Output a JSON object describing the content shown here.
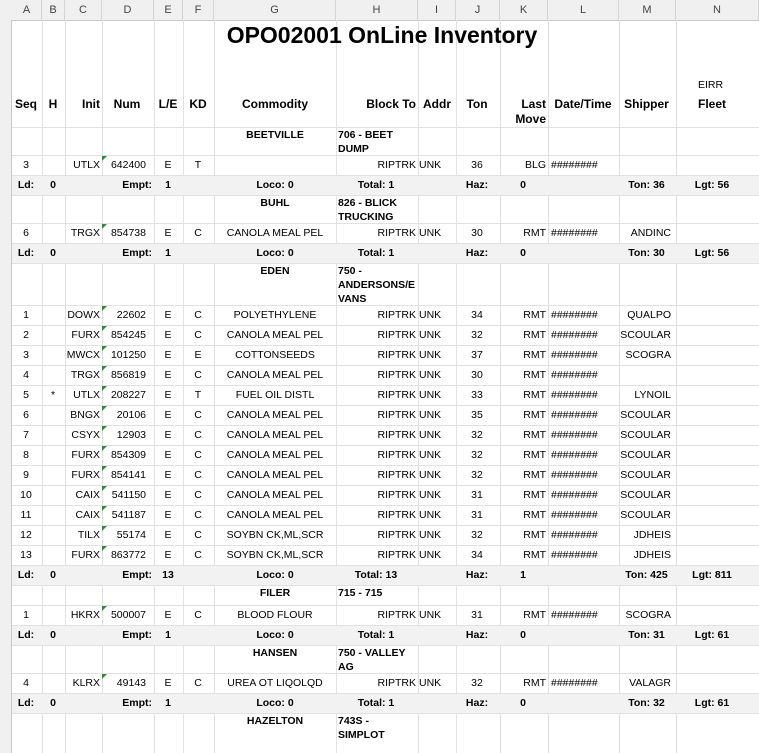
{
  "col_letters": [
    "A",
    "B",
    "C",
    "D",
    "E",
    "F",
    "G",
    "H",
    "I",
    "J",
    "K",
    "L",
    "M",
    "N"
  ],
  "title": "OPO02001 OnLine Inventory",
  "eirr": "EIRR",
  "headers": {
    "seq": "Seq",
    "h": "H",
    "init": "Init",
    "num": "Num",
    "le": "L/E",
    "kd": "KD",
    "commodity": "Commodity",
    "block": "Block To",
    "addr": "Addr",
    "ton": "Ton",
    "last1": "Last",
    "last2": "Move",
    "dt": "Date/Time",
    "shipper": "Shipper",
    "fleet": "Fleet"
  },
  "row_numbers": [
    "",
    "",
    "",
    "",
    "",
    "",
    "",
    "",
    "",
    "",
    "",
    "",
    "",
    "",
    "",
    "",
    "",
    "",
    "",
    "",
    "",
    "",
    "",
    "",
    "",
    "",
    "",
    "",
    "",
    "",
    "",
    "",
    "",
    ""
  ],
  "groups": [
    {
      "name": "BEETVILLE",
      "block": [
        "706 - BEET",
        "DUMP"
      ],
      "rows": [
        {
          "seq": "3",
          "h": "",
          "init": "UTLX",
          "num": "642400",
          "le": "E",
          "kd": "T",
          "commodity": "",
          "block": "RIPTRK",
          "addr": "UNK",
          "ton": "36",
          "last": "BLG",
          "dt": "########",
          "shipper": ""
        }
      ],
      "sum": {
        "ld": "Ld:",
        "ld_v": "0",
        "empt": "Empt:",
        "empt_v": "1",
        "loco": "Loco:  0",
        "total": "Total:  1",
        "haz": "Haz:",
        "haz_v": "0",
        "ton": "Ton: 36",
        "lgt": "Lgt: 56"
      }
    },
    {
      "name": "BUHL",
      "block": [
        "826 - BLICK",
        "TRUCKING"
      ],
      "rows": [
        {
          "seq": "6",
          "h": "",
          "init": "TRGX",
          "num": "854738",
          "le": "E",
          "kd": "C",
          "commodity": "CANOLA MEAL PEL",
          "block": "RIPTRK",
          "addr": "UNK",
          "ton": "30",
          "last": "RMT",
          "dt": "########",
          "shipper": "ANDINC"
        }
      ],
      "sum": {
        "ld": "Ld:",
        "ld_v": "0",
        "empt": "Empt:",
        "empt_v": "1",
        "loco": "Loco:  0",
        "total": "Total:  1",
        "haz": "Haz:",
        "haz_v": "0",
        "ton": "Ton: 30",
        "lgt": "Lgt: 56"
      }
    },
    {
      "name": "EDEN",
      "block": [
        "750 -",
        "ANDERSONS/E",
        "VANS"
      ],
      "rows": [
        {
          "seq": "1",
          "h": "",
          "init": "DOWX",
          "num": "22602",
          "le": "E",
          "kd": "C",
          "commodity": "POLYETHYLENE",
          "block": "RIPTRK",
          "addr": "UNK",
          "ton": "34",
          "last": "RMT",
          "dt": "########",
          "shipper": "QUALPO"
        },
        {
          "seq": "2",
          "h": "",
          "init": "FURX",
          "num": "854245",
          "le": "E",
          "kd": "C",
          "commodity": "CANOLA MEAL PEL",
          "block": "RIPTRK",
          "addr": "UNK",
          "ton": "32",
          "last": "RMT",
          "dt": "########",
          "shipper": "SCOULAR"
        },
        {
          "seq": "3",
          "h": "",
          "init": "MWCX",
          "num": "101250",
          "le": "E",
          "kd": "E",
          "commodity": "COTTONSEEDS",
          "block": "RIPTRK",
          "addr": "UNK",
          "ton": "37",
          "last": "RMT",
          "dt": "########",
          "shipper": "SCOGRA"
        },
        {
          "seq": "4",
          "h": "",
          "init": "TRGX",
          "num": "856819",
          "le": "E",
          "kd": "C",
          "commodity": "CANOLA MEAL PEL",
          "block": "RIPTRK",
          "addr": "UNK",
          "ton": "30",
          "last": "RMT",
          "dt": "########",
          "shipper": ""
        },
        {
          "seq": "5",
          "h": "*",
          "init": "UTLX",
          "num": "208227",
          "le": "E",
          "kd": "T",
          "commodity": "FUEL OIL DISTL",
          "block": "RIPTRK",
          "addr": "UNK",
          "ton": "33",
          "last": "RMT",
          "dt": "########",
          "shipper": "LYNOIL"
        },
        {
          "seq": "6",
          "h": "",
          "init": "BNGX",
          "num": "20106",
          "le": "E",
          "kd": "C",
          "commodity": "CANOLA MEAL PEL",
          "block": "RIPTRK",
          "addr": "UNK",
          "ton": "35",
          "last": "RMT",
          "dt": "########",
          "shipper": "SCOULAR"
        },
        {
          "seq": "7",
          "h": "",
          "init": "CSYX",
          "num": "12903",
          "le": "E",
          "kd": "C",
          "commodity": "CANOLA MEAL PEL",
          "block": "RIPTRK",
          "addr": "UNK",
          "ton": "32",
          "last": "RMT",
          "dt": "########",
          "shipper": "SCOULAR"
        },
        {
          "seq": "8",
          "h": "",
          "init": "FURX",
          "num": "854309",
          "le": "E",
          "kd": "C",
          "commodity": "CANOLA MEAL PEL",
          "block": "RIPTRK",
          "addr": "UNK",
          "ton": "32",
          "last": "RMT",
          "dt": "########",
          "shipper": "SCOULAR"
        },
        {
          "seq": "9",
          "h": "",
          "init": "FURX",
          "num": "854141",
          "le": "E",
          "kd": "C",
          "commodity": "CANOLA MEAL PEL",
          "block": "RIPTRK",
          "addr": "UNK",
          "ton": "32",
          "last": "RMT",
          "dt": "########",
          "shipper": "SCOULAR"
        },
        {
          "seq": "10",
          "h": "",
          "init": "CAIX",
          "num": "541150",
          "le": "E",
          "kd": "C",
          "commodity": "CANOLA MEAL PEL",
          "block": "RIPTRK",
          "addr": "UNK",
          "ton": "31",
          "last": "RMT",
          "dt": "########",
          "shipper": "SCOULAR"
        },
        {
          "seq": "11",
          "h": "",
          "init": "CAIX",
          "num": "541187",
          "le": "E",
          "kd": "C",
          "commodity": "CANOLA MEAL PEL",
          "block": "RIPTRK",
          "addr": "UNK",
          "ton": "31",
          "last": "RMT",
          "dt": "########",
          "shipper": "SCOULAR"
        },
        {
          "seq": "12",
          "h": "",
          "init": "TILX",
          "num": "55174",
          "le": "E",
          "kd": "C",
          "commodity": "SOYBN CK,ML,SCR",
          "block": "RIPTRK",
          "addr": "UNK",
          "ton": "32",
          "last": "RMT",
          "dt": "########",
          "shipper": "JDHEIS"
        },
        {
          "seq": "13",
          "h": "",
          "init": "FURX",
          "num": "863772",
          "le": "E",
          "kd": "C",
          "commodity": "SOYBN CK,ML,SCR",
          "block": "RIPTRK",
          "addr": "UNK",
          "ton": "34",
          "last": "RMT",
          "dt": "########",
          "shipper": "JDHEIS"
        }
      ],
      "sum": {
        "ld": "Ld:",
        "ld_v": "0",
        "empt": "Empt:",
        "empt_v": "13",
        "loco": "Loco:  0",
        "total": "Total:  13",
        "haz": "Haz:",
        "haz_v": "1",
        "ton": "Ton: 425",
        "lgt": "Lgt: 811"
      }
    },
    {
      "name": "FILER",
      "block": [
        "715 - 715"
      ],
      "rows": [
        {
          "seq": "1",
          "h": "",
          "init": "HKRX",
          "num": "500007",
          "le": "E",
          "kd": "C",
          "commodity": "BLOOD FLOUR",
          "block": "RIPTRK",
          "addr": "UNK",
          "ton": "31",
          "last": "RMT",
          "dt": "########",
          "shipper": "SCOGRA"
        }
      ],
      "sum": {
        "ld": "Ld:",
        "ld_v": "0",
        "empt": "Empt:",
        "empt_v": "1",
        "loco": "Loco:  0",
        "total": "Total:  1",
        "haz": "Haz:",
        "haz_v": "0",
        "ton": "Ton: 31",
        "lgt": "Lgt: 61"
      }
    },
    {
      "name": "HANSEN",
      "block": [
        "750 - VALLEY",
        "AG"
      ],
      "rows": [
        {
          "seq": "4",
          "h": "",
          "init": "KLRX",
          "num": "49143",
          "le": "E",
          "kd": "C",
          "commodity": "UREA OT LIQOLQD",
          "block": "RIPTRK",
          "addr": "UNK",
          "ton": "32",
          "last": "RMT",
          "dt": "########",
          "shipper": "VALAGR"
        }
      ],
      "sum": {
        "ld": "Ld:",
        "ld_v": "0",
        "empt": "Empt:",
        "empt_v": "1",
        "loco": "Loco:  0",
        "total": "Total:  1",
        "haz": "Haz:",
        "haz_v": "0",
        "ton": "Ton: 32",
        "lgt": "Lgt: 61"
      }
    },
    {
      "name": "HAZELTON",
      "block": [
        "743S -",
        "SIMPLOT"
      ],
      "rows": [],
      "sum": null
    }
  ]
}
